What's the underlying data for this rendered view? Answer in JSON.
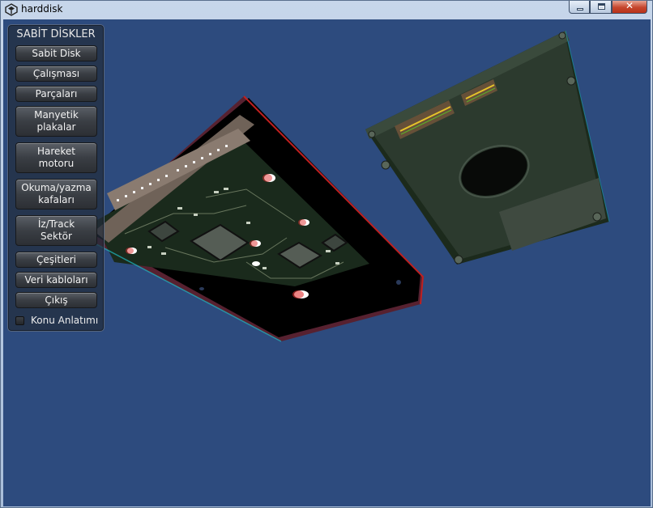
{
  "window": {
    "title": "harddisk",
    "controls": {
      "minimize": "minimize",
      "maximize": "maximize",
      "close": "✕"
    }
  },
  "menu": {
    "title": "SABİT DİSKLER",
    "buttons": [
      {
        "label": "Sabit Disk"
      },
      {
        "label": "Çalışması"
      },
      {
        "label": "Parçaları"
      },
      {
        "label": "Manyetik\nplakalar"
      },
      {
        "label": "Hareket\nmotoru"
      },
      {
        "label": "Okuma/yazma\nkafaları"
      },
      {
        "label": "İz/Track\nSektör"
      },
      {
        "label": "Çeşitleri"
      },
      {
        "label": "Veri kabloları"
      },
      {
        "label": "Çıkış"
      }
    ],
    "toggle": {
      "label": "Konu Anlatımı",
      "checked": false
    }
  },
  "scene": {
    "background_color": "#2d4b7e",
    "objects": [
      "3.5-inch hard disk (circuit board side)",
      "2.5-inch hard disk (bottom side)"
    ]
  }
}
